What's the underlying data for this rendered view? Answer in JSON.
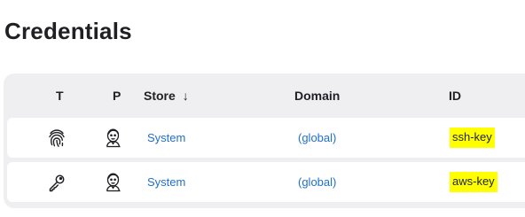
{
  "page": {
    "title": "Credentials"
  },
  "table": {
    "columns": {
      "type": "T",
      "provider": "P",
      "store": "Store",
      "store_sort_indicator": "↓",
      "domain": "Domain",
      "id": "ID"
    },
    "rows": [
      {
        "type_icon": "fingerprint-icon",
        "provider_icon": "jenkins-butler-icon",
        "store": "System",
        "domain": "(global)",
        "id": "ssh-key"
      },
      {
        "type_icon": "key-icon",
        "provider_icon": "jenkins-butler-icon",
        "store": "System",
        "domain": "(global)",
        "id": "aws-key"
      }
    ]
  },
  "colors": {
    "link": "#1f6fd1",
    "highlight": "#ffff00",
    "table_background": "#efeff2"
  }
}
